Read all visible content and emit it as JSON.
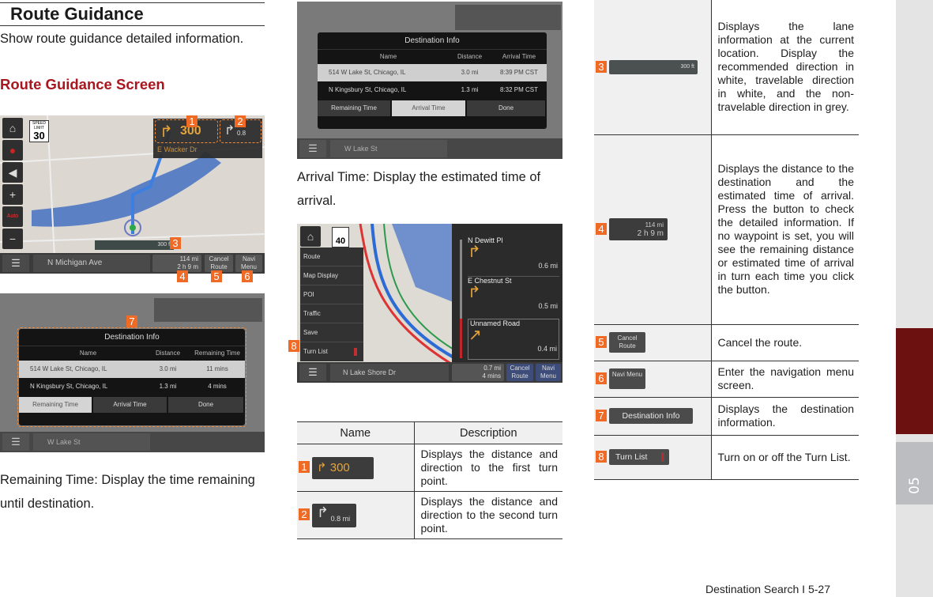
{
  "section": {
    "title": "Route Guidance",
    "intro": "Show route guidance detailed information.",
    "subheading": "Route Guidance Screen"
  },
  "nav_screen": {
    "speed_limit_label": "SPEED LIMIT",
    "speed_limit": "30",
    "turn1_distance": "300",
    "turn1_street": "E Wacker Dr",
    "turn2_distance": "0.8",
    "lane_distance": "300 ft",
    "current_street": "N Michigan Ave",
    "remaining_distance": "114 mi",
    "remaining_time": "2 h 9 m",
    "cancel_route": "Cancel Route",
    "navi_menu": "Navi Menu",
    "callouts": [
      "1",
      "2",
      "3",
      "4",
      "5",
      "6"
    ]
  },
  "destination_info_remaining": {
    "callout": "7",
    "title": "Destination Info",
    "headers": [
      "Name",
      "Distance",
      "Remaining Time"
    ],
    "rows": [
      {
        "name": "514 W Lake St, Chicago, IL",
        "distance": "3.0 mi",
        "value": "11 mins"
      },
      {
        "name": "N Kingsbury St, Chicago, IL",
        "distance": "1.3 mi",
        "value": "4 mins"
      }
    ],
    "buttons": [
      "Remaining Time",
      "Arrival Time",
      "Done"
    ],
    "active_button": "Remaining Time",
    "bottom_street": "W Lake St"
  },
  "destination_info_arrival": {
    "title": "Destination Info",
    "headers": [
      "Name",
      "Distance",
      "Arrival Time"
    ],
    "rows": [
      {
        "name": "514 W Lake St, Chicago, IL",
        "distance": "3.0 mi",
        "value": "8:39 PM CST"
      },
      {
        "name": "N Kingsbury St, Chicago, IL",
        "distance": "1.3 mi",
        "value": "8:32 PM CST"
      }
    ],
    "buttons": [
      "Remaining Time",
      "Arrival Time",
      "Done"
    ],
    "active_button": "Arrival Time",
    "bottom_street": "W Lake St"
  },
  "captions": {
    "remaining": "Remaining Time: Display the time remaining until destination.",
    "arrival": "Arrival Time: Display the estimated time of arrival."
  },
  "turn_list_screen": {
    "callout": "8",
    "speed_limit": "40",
    "menu": [
      "Route",
      "Map Display",
      "POI",
      "Traffic",
      "Save",
      "Turn List"
    ],
    "turns": [
      {
        "street": "N Dewitt Pl",
        "distance": "0.6 mi"
      },
      {
        "street": "E Chestnut St",
        "distance": "0.5 mi"
      },
      {
        "street": "Unnamed Road",
        "distance": "0.4 mi"
      }
    ],
    "current_street": "N Lake Shore Dr",
    "remaining_distance": "0.7 mi",
    "remaining_time": "4 mins",
    "cancel_route": "Cancel Route",
    "navi_menu": "Navi Menu"
  },
  "table": {
    "headers": [
      "Name",
      "Description"
    ],
    "rows": [
      {
        "num": "1",
        "chip": "300",
        "description": "Displays the distance and direction to the first turn point."
      },
      {
        "num": "2",
        "chip": "0.8 mi",
        "description": "Displays the distance and direction to the second turn point."
      },
      {
        "num": "3",
        "chip": "300 ft",
        "description": "Displays the lane information at the current location. Display the recommended direction in white, travelable direction in white, and the non-travelable direction in grey."
      },
      {
        "num": "4",
        "chip_line1": "114 mi",
        "chip_line2": "2 h 9 m",
        "description": "Displays the distance to the destination and the estimated time of arrival. Press the button to check the detailed information. If no waypoint is set, you will see the remaining distance or estimated time of arrival in turn each time you click the button."
      },
      {
        "num": "5",
        "chip": "Cancel Route",
        "description": "Cancel the route."
      },
      {
        "num": "6",
        "chip": "Navi Menu",
        "description": "Enter the navigation menu screen."
      },
      {
        "num": "7",
        "chip": "Destination Info",
        "description": "Displays the destination information."
      },
      {
        "num": "8",
        "chip": "Turn List",
        "description": "Turn on or off the Turn List."
      }
    ]
  },
  "chapter": "05",
  "footer": "Destination Search I 5-27",
  "colors": {
    "accent_red": "#a8161e",
    "callout_orange": "#ef6a25",
    "chapter_tab_dark": "#6c1110",
    "chapter_tab_grey": "#bcbdc0"
  }
}
